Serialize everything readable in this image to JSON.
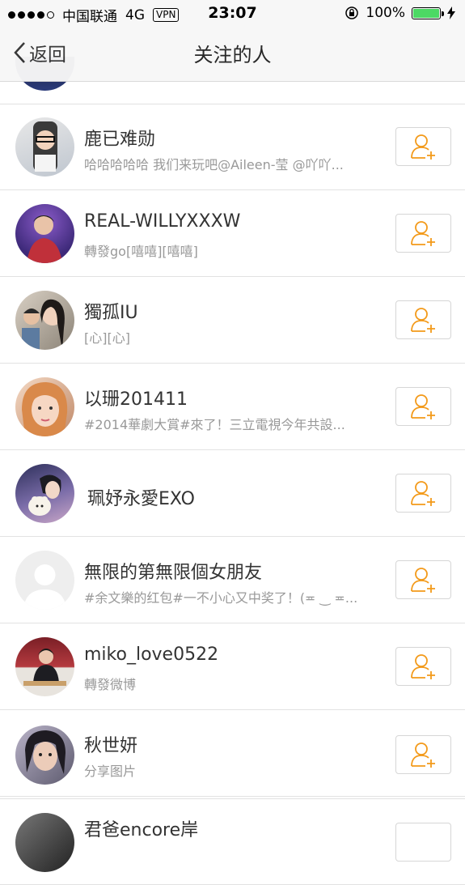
{
  "status_bar": {
    "carrier": "中国联通",
    "network": "4G",
    "vpn": "VPN",
    "time": "23:07",
    "battery": "100%"
  },
  "nav": {
    "back_label": "返回",
    "title": "关注的人"
  },
  "colors": {
    "accent": "#f39a1a",
    "battery_green": "#4cd964"
  },
  "users": [
    {
      "name": "鹿已难勋",
      "desc": "哈哈哈哈哈 我们来玩吧@Aileen-莹 @吖吖..."
    },
    {
      "name": "REAL-WILLYXXXW",
      "desc": "轉發go[嘻嘻][嘻嘻]"
    },
    {
      "name": "獨孤IU",
      "desc": "[心][心]"
    },
    {
      "name": "以珊201411",
      "desc": "#2014華劇大賞#來了！三立電視今年共設..."
    },
    {
      "name": "珮妤永愛EXO",
      "desc": ""
    },
    {
      "name": "無限的第無限個女朋友",
      "desc": "#余文樂的红包#一不小心又中奖了！(≖ ‿ ≖..."
    },
    {
      "name": "miko_love0522",
      "desc": "轉發微博"
    },
    {
      "name": "秋世妍",
      "desc": "分享图片"
    },
    {
      "name": "君爸encore岸",
      "desc": ""
    }
  ]
}
